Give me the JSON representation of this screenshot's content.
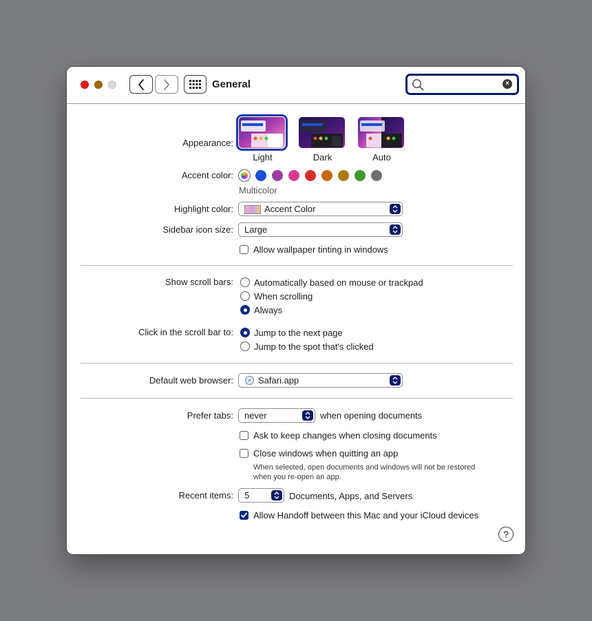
{
  "window": {
    "title": "General",
    "search_value": ""
  },
  "appearance": {
    "label": "Appearance:",
    "options": [
      {
        "name": "Light",
        "selected": true
      },
      {
        "name": "Dark",
        "selected": false
      },
      {
        "name": "Auto",
        "selected": false
      }
    ]
  },
  "accent": {
    "label": "Accent color:",
    "selected_name": "Multicolor",
    "colors": [
      "multicolor",
      "#1a4fd6",
      "#9b3fa2",
      "#d63c8e",
      "#d32f2f",
      "#c7690f",
      "#a87b10",
      "#3f9a2a",
      "#707070"
    ]
  },
  "highlight": {
    "label": "Highlight color:",
    "value": "Accent Color"
  },
  "sidebar_icon": {
    "label": "Sidebar icon size:",
    "value": "Large"
  },
  "wallpaper_tinting": {
    "label": "Allow wallpaper tinting in windows",
    "checked": false
  },
  "scroll_bars": {
    "label": "Show scroll bars:",
    "options": [
      {
        "label": "Automatically based on mouse or trackpad",
        "selected": false
      },
      {
        "label": "When scrolling",
        "selected": false
      },
      {
        "label": "Always",
        "selected": true
      }
    ]
  },
  "click_scroll": {
    "label": "Click in the scroll bar to:",
    "options": [
      {
        "label": "Jump to the next page",
        "selected": true
      },
      {
        "label": "Jump to the spot that's clicked",
        "selected": false
      }
    ]
  },
  "browser": {
    "label": "Default web browser:",
    "value": "Safari.app"
  },
  "tabs": {
    "label": "Prefer tabs:",
    "value": "never",
    "suffix": "when opening documents"
  },
  "ask_keep": {
    "label": "Ask to keep changes when closing documents",
    "checked": false
  },
  "close_windows": {
    "label": "Close windows when quitting an app",
    "checked": false,
    "note_line1": "When selected, open documents and windows will not be restored",
    "note_line2": "when you re-open an app."
  },
  "recent": {
    "label": "Recent items:",
    "value": "5",
    "suffix": "Documents, Apps, and Servers"
  },
  "handoff": {
    "label": "Allow Handoff between this Mac and your iCloud devices",
    "checked": true
  },
  "help": {
    "symbol": "?"
  },
  "colors": {
    "accent_blue": "#0a2a7c",
    "close": "#e0201d",
    "minimize": "#a0690f",
    "zoom": "#d9d9d9"
  }
}
